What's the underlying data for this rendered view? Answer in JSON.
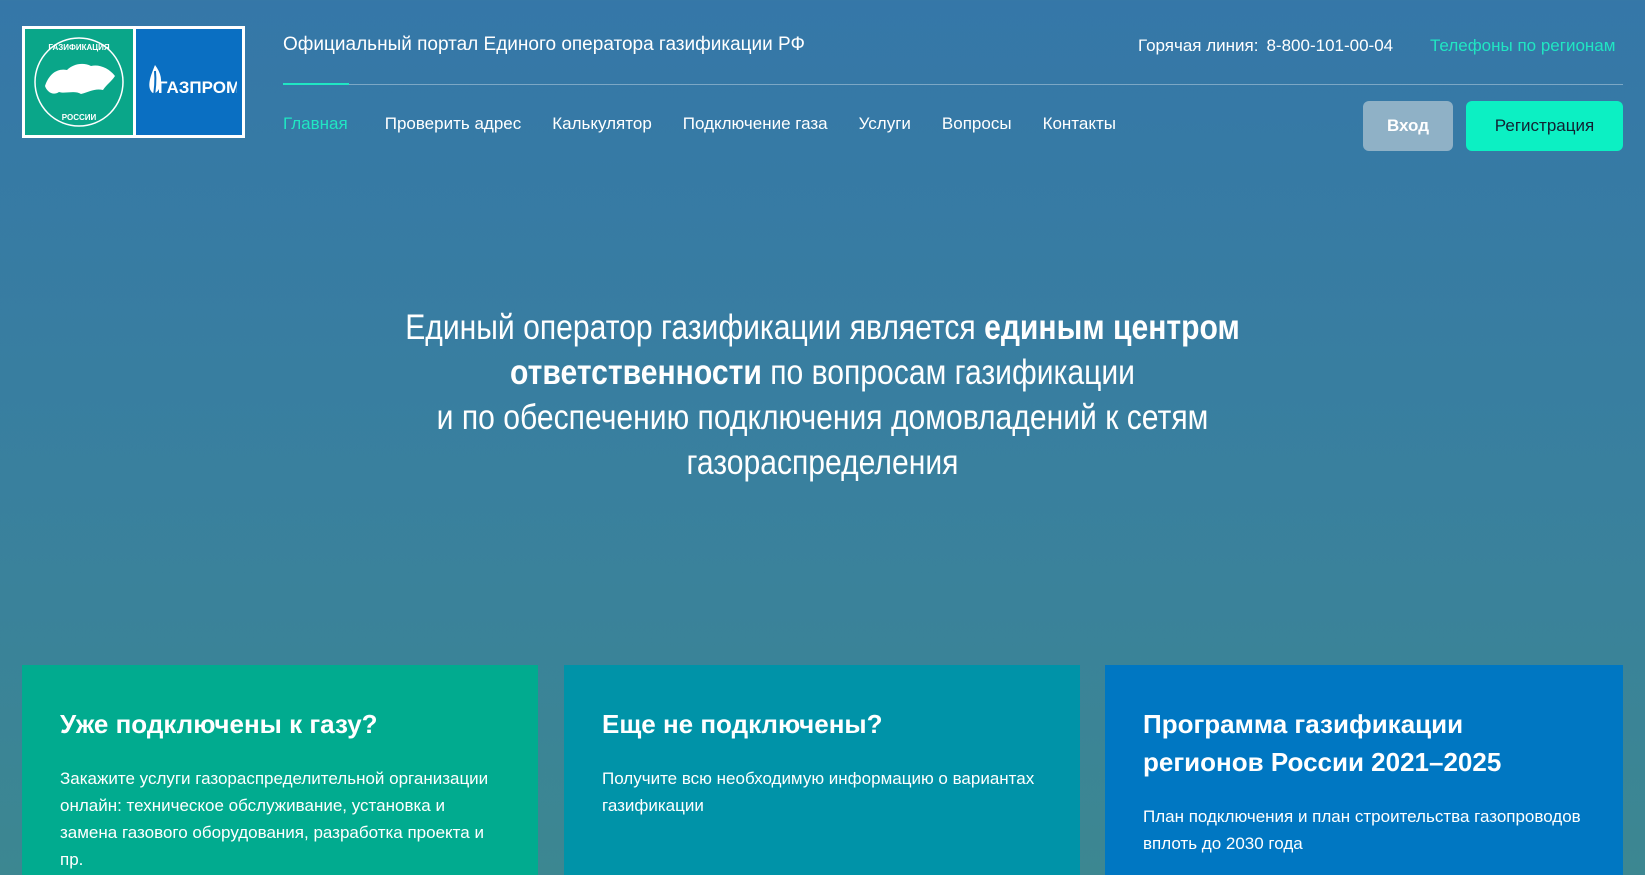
{
  "header": {
    "portal_title": "Официальный портал Единого оператора газификации РФ",
    "hotline_label": "Горячая линия:",
    "hotline_phone": "8-800-101-00-04",
    "regions_link": "Телефоны по регионам",
    "logo_left_alt": "газификация России",
    "logo_right_text": "ГАЗПРОМ"
  },
  "nav": {
    "items": [
      {
        "label": "Главная"
      },
      {
        "label": "Проверить адрес"
      },
      {
        "label": "Калькулятор"
      },
      {
        "label": "Подключение газа"
      },
      {
        "label": "Услуги"
      },
      {
        "label": "Вопросы"
      },
      {
        "label": "Контакты"
      }
    ],
    "login": "Вход",
    "register": "Регистрация"
  },
  "hero": {
    "part1": "Единый оператор газификации является ",
    "bold": "единым центром ответственности",
    "part2": " по вопросам газификации",
    "line3": "и по обеспечению подключения домовладений к сетям газораспределения"
  },
  "cards": [
    {
      "title": "Уже подключены к газу?",
      "text": "Закажите услуги газораспределительной организации онлайн: техническое обслуживание, установка и замена газового оборудования, разработка проекта и пр."
    },
    {
      "title": "Еще не подключены?",
      "text": "Получите всю необходимую информацию о вариантах газификации"
    },
    {
      "title": "Программа газификации регионов России 2021–2025",
      "text": "План подключения и план строительства газопроводов вплоть до 2030 года"
    }
  ],
  "colors": {
    "accent": "#20e6c3",
    "register_button": "#0cf0c3",
    "card_green": "#01ab8f",
    "card_teal": "#0093a8",
    "card_blue": "#0077c2"
  }
}
